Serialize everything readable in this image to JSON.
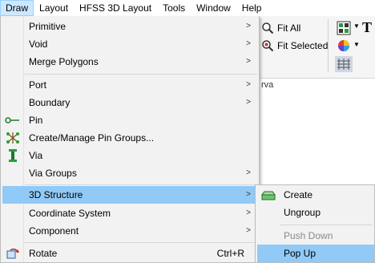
{
  "menubar": {
    "items": [
      "Draw",
      "Layout",
      "HFSS 3D Layout",
      "Tools",
      "Window",
      "Help"
    ],
    "active": "Draw"
  },
  "toolbar": {
    "fit_all_label": "Fit All",
    "fit_selected_label": "Fit Selected",
    "caption_fragment": "rva"
  },
  "draw_menu": {
    "items": [
      {
        "label": "Primitive",
        "submenu": true,
        "icon": ""
      },
      {
        "label": "Void",
        "submenu": true,
        "icon": ""
      },
      {
        "label": "Merge Polygons",
        "submenu": true,
        "icon": ""
      },
      {
        "label": "Port",
        "submenu": true,
        "icon": ""
      },
      {
        "label": "Boundary",
        "submenu": true,
        "icon": ""
      },
      {
        "label": "Pin",
        "submenu": false,
        "icon": "pin-icon"
      },
      {
        "label": "Create/Manage Pin Groups...",
        "submenu": false,
        "icon": "pin-groups-icon"
      },
      {
        "label": "Via",
        "submenu": false,
        "icon": "via-icon"
      },
      {
        "label": "Via Groups",
        "submenu": true,
        "icon": ""
      },
      {
        "label": "3D Structure",
        "submenu": true,
        "icon": "",
        "highlighted": true
      },
      {
        "label": "Coordinate System",
        "submenu": true,
        "icon": ""
      },
      {
        "label": "Component",
        "submenu": true,
        "icon": ""
      },
      {
        "label": "Rotate",
        "submenu": false,
        "icon": "rotate-icon",
        "shortcut": "Ctrl+R"
      }
    ]
  },
  "structure_submenu": {
    "items": [
      {
        "label": "Create",
        "icon": "3d-structure-icon",
        "disabled": false
      },
      {
        "label": "Ungroup",
        "icon": "",
        "disabled": false
      },
      {
        "label": "Push Down",
        "icon": "",
        "disabled": true
      },
      {
        "label": "Pop Up",
        "icon": "",
        "disabled": false,
        "highlighted": true
      }
    ]
  },
  "colors": {
    "highlight": "#91c9f7",
    "menu_bg": "#f2f2f2",
    "active_menubar": "#cce8ff",
    "disabled_text": "#8a8a8a"
  }
}
